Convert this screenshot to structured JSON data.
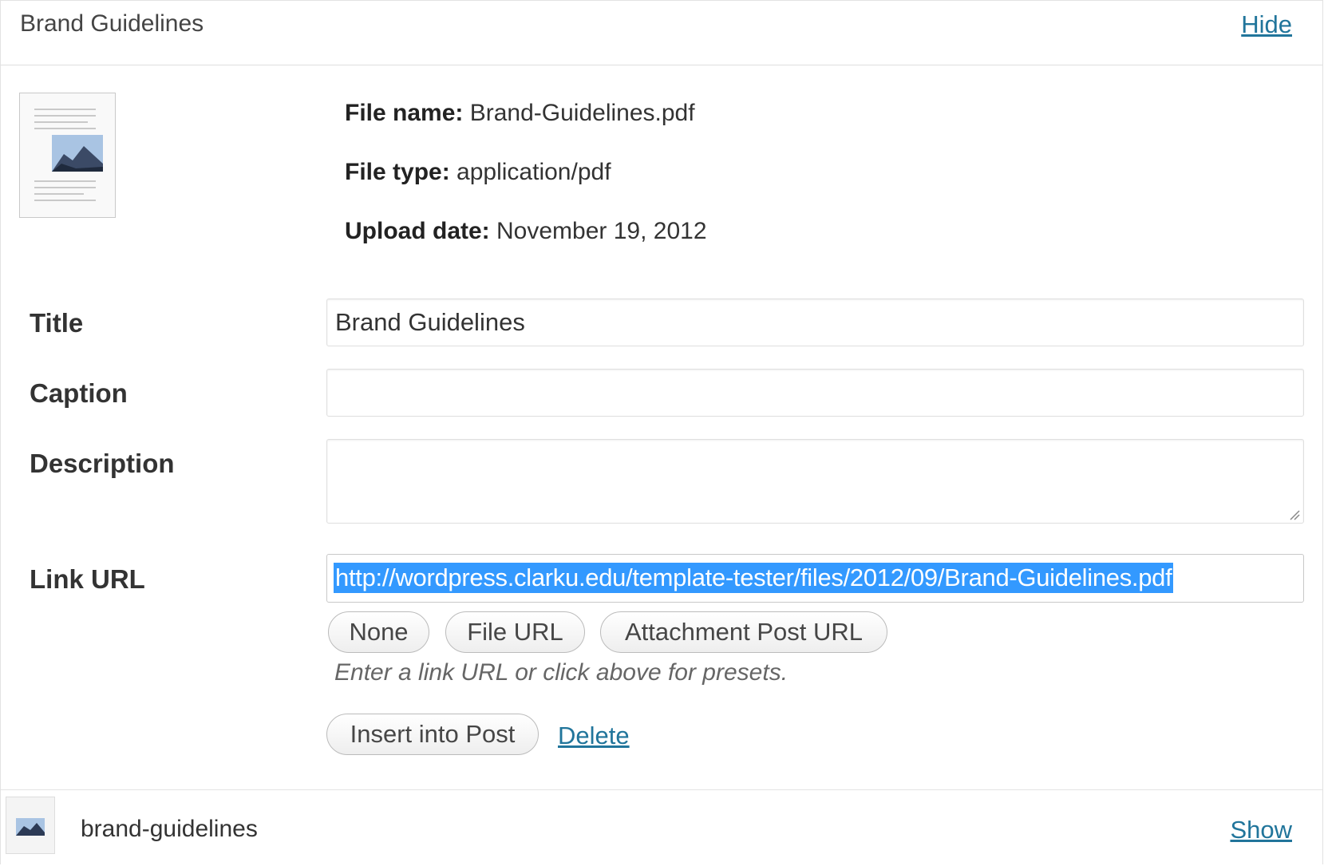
{
  "header": {
    "title": "Brand Guidelines",
    "hide_label": "Hide"
  },
  "file_info": {
    "name_label": "File name:",
    "name_value": "Brand-Guidelines.pdf",
    "type_label": "File type:",
    "type_value": "application/pdf",
    "date_label": "Upload date:",
    "date_value": "November 19, 2012"
  },
  "form": {
    "title_label": "Title",
    "title_value": "Brand Guidelines",
    "caption_label": "Caption",
    "caption_value": "",
    "description_label": "Description",
    "description_value": "",
    "link_url_label": "Link URL",
    "link_url_value": "http://wordpress.clarku.edu/template-tester/files/2012/09/Brand-Guidelines.pdf",
    "preset_buttons": [
      "None",
      "File URL",
      "Attachment Post URL"
    ],
    "hint": "Enter a link URL or click above for presets.",
    "insert_label": "Insert into Post",
    "delete_label": "Delete"
  },
  "footer_item": {
    "title": "brand-guidelines",
    "show_label": "Show"
  },
  "colors": {
    "link": "#21759b",
    "selection": "#3399ff"
  },
  "icons": {
    "thumbnail": "document-thumbnail-icon",
    "footer_thumbnail": "document-thumbnail-icon",
    "resize": "resize-handle-icon"
  }
}
